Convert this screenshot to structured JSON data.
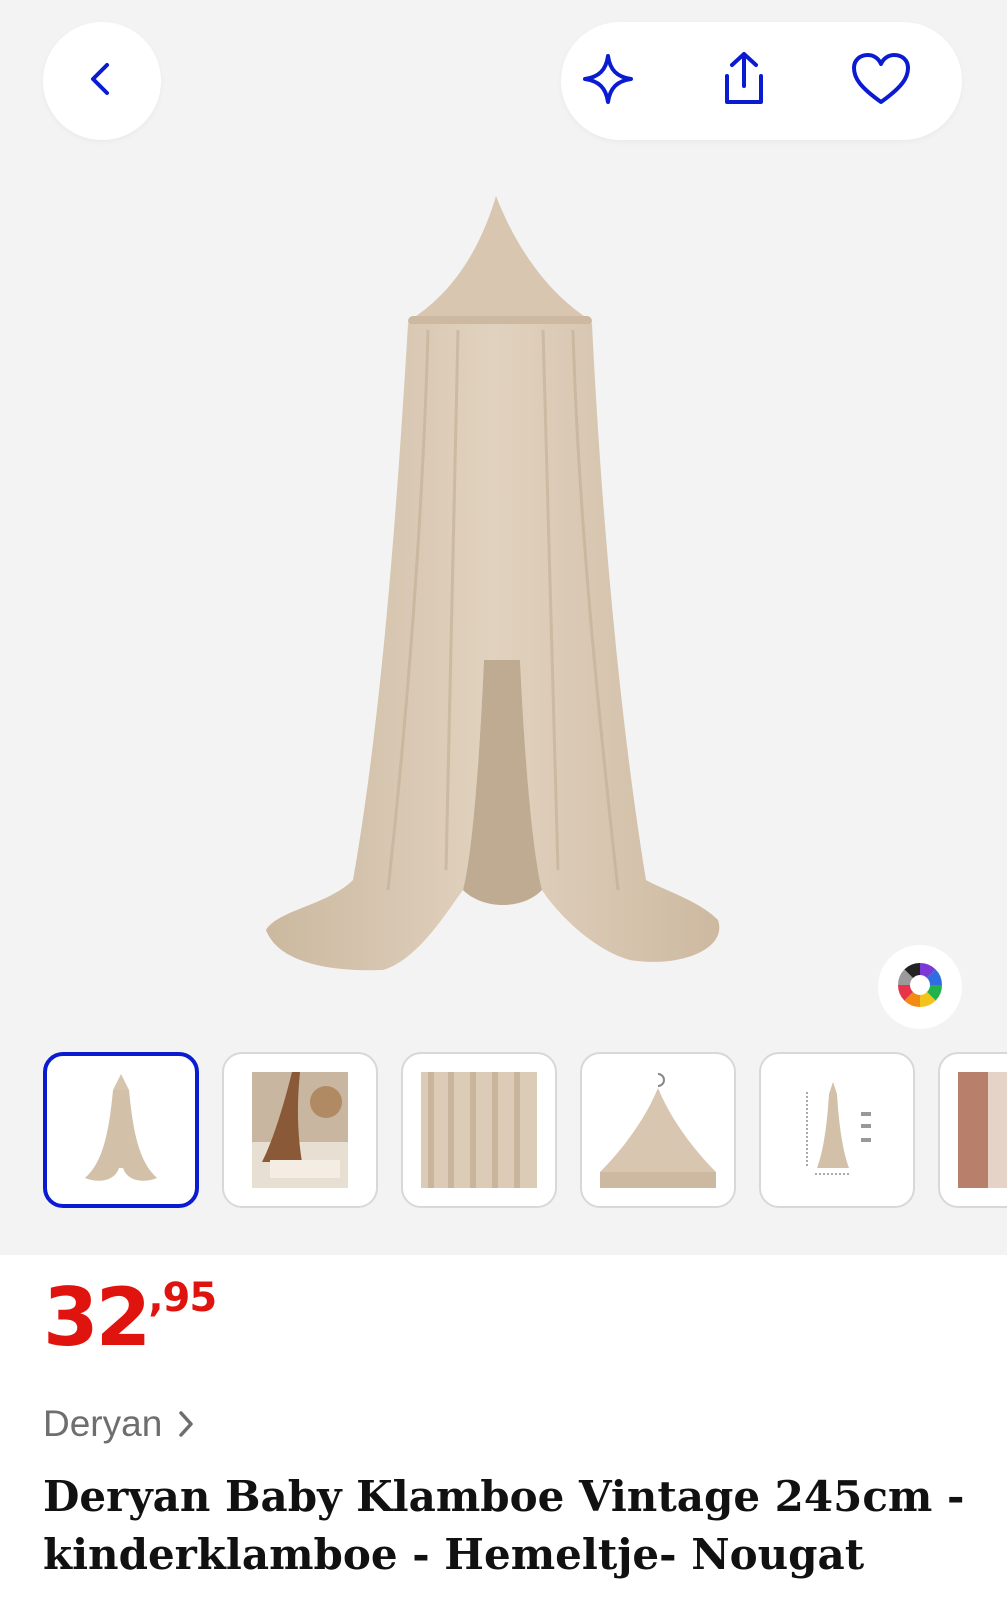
{
  "colors": {
    "accent": "#0a1bd1",
    "price": "#e0140f",
    "fabric": "#d9c7b0"
  },
  "header": {
    "back_icon": "chevron-left-icon",
    "actions": [
      "sparkle-icon",
      "share-icon",
      "heart-icon"
    ]
  },
  "gallery": {
    "main_image": "baby-canopy-nougat",
    "color_picker_icon": "color-wheel-icon",
    "thumbnails": [
      "canopy-full",
      "canopy-room-scene",
      "fabric-closeup",
      "canopy-top-hook",
      "canopy-dimensions",
      "room-photo-partial"
    ],
    "selected_index": 0
  },
  "product": {
    "price_int": "32",
    "price_dec": ",95",
    "brand": "Deryan",
    "title": "Deryan Baby Klamboe Vintage 245cm - kinderklamboe - Hemeltje- Nougat"
  }
}
